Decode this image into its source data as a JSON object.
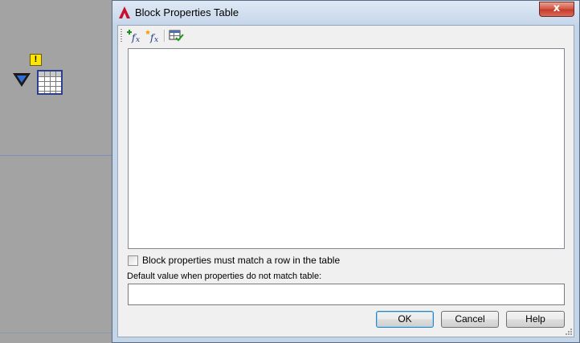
{
  "dialog": {
    "title": "Block Properties Table",
    "close_label": "x"
  },
  "toolbar": {
    "items": [
      {
        "icon": "add-property-fx-icon"
      },
      {
        "icon": "new-user-parameter-fx-icon"
      },
      {
        "icon": "audit-table-icon"
      }
    ]
  },
  "options": {
    "must_match_label": "Block properties must match a row in the table",
    "must_match_checked": false,
    "default_value_label": "Default value when properties do not match table:",
    "default_value": ""
  },
  "buttons": {
    "ok": "OK",
    "cancel": "Cancel",
    "help": "Help"
  },
  "canvas": {
    "warning_badge": "!"
  }
}
